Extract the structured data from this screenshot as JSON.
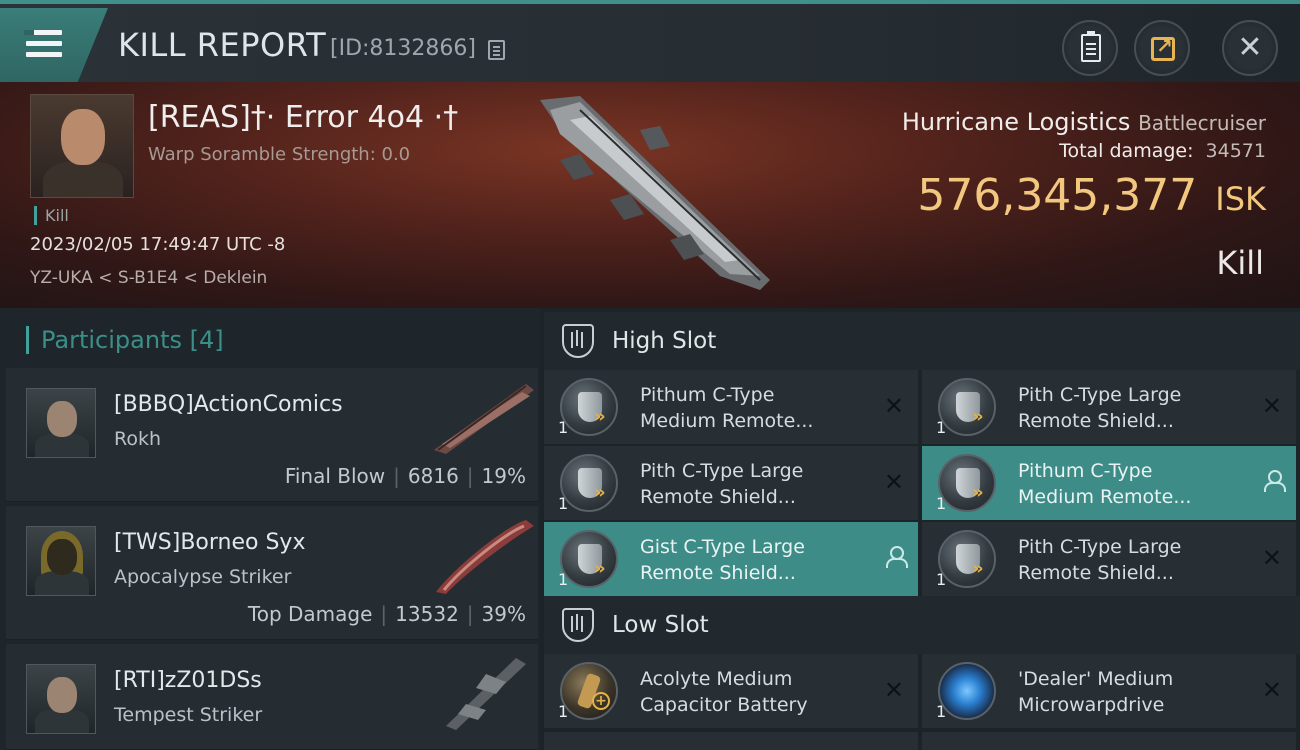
{
  "header": {
    "title": "KILL REPORT",
    "report_id": "[ID:8132866]"
  },
  "banner": {
    "pilot_name": "[REAS]†· Error 4o4 ·†",
    "scramble": "Warp Soramble Strength: 0.0",
    "kill_tag": "Kill",
    "time": "2023/02/05 17:49:47 UTC -8",
    "location": "YZ-UKA < S-B1E4 < Deklein",
    "ship_name": "Hurricane Logistics",
    "ship_class": "Battlecruiser",
    "damage_label": "Total damage:",
    "damage_value": "34571",
    "isk_value": "576,345,377",
    "isk_unit": "ISK",
    "result": "Kill"
  },
  "participants": {
    "title": "Participants",
    "count": "[4]",
    "rows": [
      {
        "name": "[BBBQ]ActionComics",
        "ship": "Rokh",
        "role": "Final Blow",
        "damage": "6816",
        "percent": "19%"
      },
      {
        "name": "[TWS]Borneo Syx",
        "ship": "Apocalypse Striker",
        "role": "Top Damage",
        "damage": "13532",
        "percent": "39%"
      },
      {
        "name": "[RTI]zZ01DSs",
        "ship": "Tempest Striker",
        "role": "",
        "damage": "",
        "percent": ""
      }
    ]
  },
  "slots": {
    "high_label": "High Slot",
    "low_label": "Low Slot",
    "high": [
      {
        "qty": "1",
        "line1": "Pithum C-Type",
        "line2": "Medium Remote...",
        "icon": "shield-icon",
        "state": "destroyed"
      },
      {
        "qty": "1",
        "line1": "Pith C-Type Large",
        "line2": "Remote Shield...",
        "icon": "shield-icon",
        "state": "destroyed"
      },
      {
        "qty": "1",
        "line1": "Pith C-Type Large",
        "line2": "Remote Shield...",
        "icon": "shield-icon",
        "state": "destroyed"
      },
      {
        "qty": "1",
        "line1": "Pithum C-Type",
        "line2": "Medium Remote...",
        "icon": "shield-icon",
        "state": "dropped"
      },
      {
        "qty": "1",
        "line1": "Gist C-Type Large",
        "line2": "Remote Shield...",
        "icon": "shield-icon",
        "state": "dropped"
      },
      {
        "qty": "1",
        "line1": "Pith C-Type Large",
        "line2": "Remote Shield...",
        "icon": "shield-icon",
        "state": "destroyed"
      }
    ],
    "low": [
      {
        "qty": "1",
        "line1": "Acolyte Medium",
        "line2": "Capacitor Battery",
        "icon": "capacitor-battery-icon",
        "state": "destroyed"
      },
      {
        "qty": "1",
        "line1": "'Dealer' Medium",
        "line2": "Microwarpdrive",
        "icon": "microwarpdrive-icon",
        "state": "destroyed"
      }
    ]
  },
  "colors": {
    "accent": "#3fa39b",
    "highlight_row": "#3d8c88",
    "isk": "#f2c77e"
  }
}
